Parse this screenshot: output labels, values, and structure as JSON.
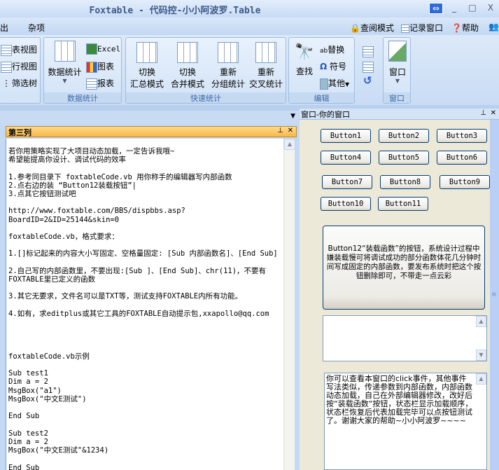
{
  "window": {
    "title": "Foxtable - 代码控-小小阿波罗.Table",
    "restore": "⇔",
    "minimize": "_",
    "maximize": "□",
    "close": "X"
  },
  "menu": {
    "items": [
      "出",
      "杂项"
    ],
    "right": [
      "查阅模式",
      "记录窗口",
      "帮助"
    ]
  },
  "ribbon": {
    "view": {
      "items": [
        "表视图",
        "行视图",
        "筛选树"
      ]
    },
    "stats": {
      "label": "数据统计",
      "big": "数据统计",
      "items": [
        "Excel",
        "图表",
        "报表"
      ]
    },
    "quick": {
      "label": "快速统计",
      "items": [
        [
          "切换",
          "汇总模式"
        ],
        [
          "切换",
          "合并模式"
        ],
        [
          "重新",
          "分组统计"
        ],
        [
          "重新",
          "交叉统计"
        ]
      ]
    },
    "edit": {
      "label": "编辑",
      "big": "查找",
      "items": [
        "替换",
        "符号",
        "其他"
      ]
    },
    "window": {
      "label": "窗口",
      "big": "窗口"
    }
  },
  "left": {
    "header": "第三列",
    "content": "若你用策略实现了大项目动态加载，一定告诉我哦~\n希望能提高你设计、调试代码的效率\n\n1.参考同目录下 foxtableCode.vb 用你称手的编辑器写内部函数\n2.点右边的装 “Button12装载按钮”|\n3.点其它按钮测试吧\n\nhttp://www.foxtable.com/BBS/dispbbs.asp?BoardID=2&ID=25144&skin=0\n\nfoxtableCode.vb，格式要求：\n\n1.[]标记起来的内容大小写固定、空格量固定: [Sub 内部函数名]、[End Sub]\n\n2.自己写的内部函数里，不要出现:[Sub ]、[End Sub]、chr(11)，不要有FOXTABLE里已定义的函数\n\n3.其它无要求，文件名可以是TXT等，测试支持FOXTABLE内所有功能。\n\n4.如有，求editplus或其它工具的FOXTABLE自动提示包,xxapollo@qq.com\n\n\n\n\nfoxtableCode.vb示例\n\nSub test1\nDim a = 2\nMsgBox(\"a1\")\nMsgBox(\"中文E测试\")\n\nEnd Sub\n\nSub test2\nDim a = 2\nMsgBox(\"中文E测试\"&1234)\n\nEnd Sub"
  },
  "right": {
    "title": "窗口-你的窗口",
    "buttons": [
      "Button1",
      "Button2",
      "Button3",
      "Button4",
      "Button5",
      "Button6",
      "Button7",
      "Button8",
      "Button9",
      "Button10",
      "Button11"
    ],
    "button12": "Button12“装载函数”的按钮，系统设计过程中嫌装载慢可将调试成功的部分函数体花几分钟时间写成固定的内部函数，要发布系统时把这个按钮删除即可，不带走一点云彩",
    "textbox1": "",
    "textbox2": "你可以查看本窗口的click事件，其他事件写法类似，传递参数到内部函数，内部函数动态加载，自己在外部编辑器修改，改好后按“装载函数“按钮，状态栏显示加载顺序，状态栏恢复后代表加载完毕可以点按钮测试了。谢谢大家的帮助~小小阿波罗~~~~"
  }
}
